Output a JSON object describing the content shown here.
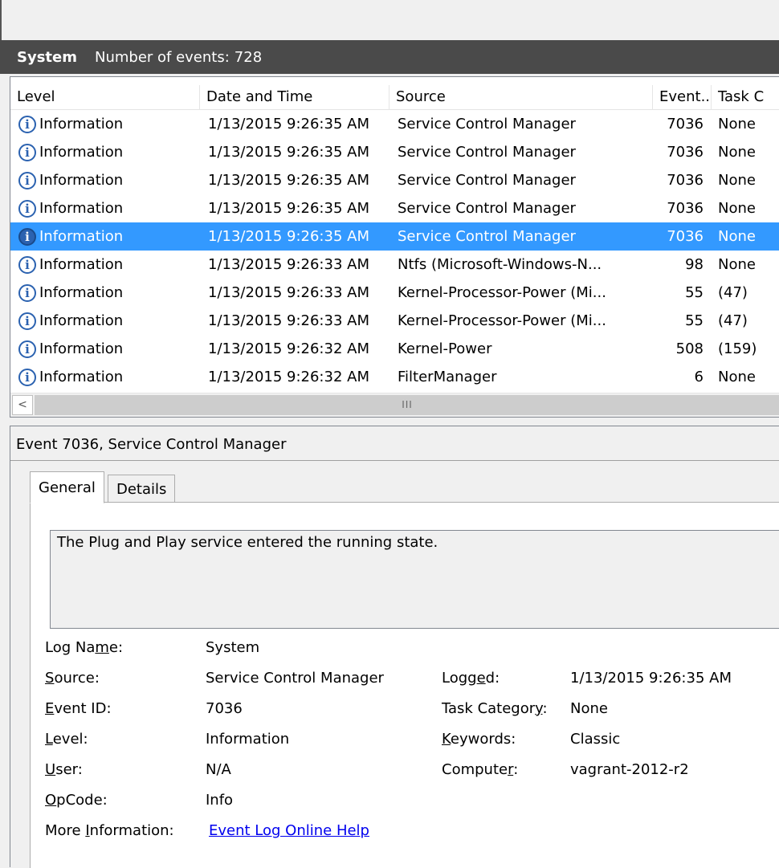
{
  "log": {
    "name": "System",
    "events_label": "Number of events:",
    "events_count": "728"
  },
  "columns": [
    "Level",
    "Date and Time",
    "Source",
    "Event...",
    "Task C"
  ],
  "events": [
    {
      "level": "Information",
      "date": "1/13/2015 9:26:35 AM",
      "source": "Service Control Manager",
      "event_id": "7036",
      "task": "None",
      "selected": false
    },
    {
      "level": "Information",
      "date": "1/13/2015 9:26:35 AM",
      "source": "Service Control Manager",
      "event_id": "7036",
      "task": "None",
      "selected": false
    },
    {
      "level": "Information",
      "date": "1/13/2015 9:26:35 AM",
      "source": "Service Control Manager",
      "event_id": "7036",
      "task": "None",
      "selected": false
    },
    {
      "level": "Information",
      "date": "1/13/2015 9:26:35 AM",
      "source": "Service Control Manager",
      "event_id": "7036",
      "task": "None",
      "selected": false
    },
    {
      "level": "Information",
      "date": "1/13/2015 9:26:35 AM",
      "source": "Service Control Manager",
      "event_id": "7036",
      "task": "None",
      "selected": true
    },
    {
      "level": "Information",
      "date": "1/13/2015 9:26:33 AM",
      "source": "Ntfs (Microsoft-Windows-N...",
      "event_id": "98",
      "task": "None",
      "selected": false
    },
    {
      "level": "Information",
      "date": "1/13/2015 9:26:33 AM",
      "source": "Kernel-Processor-Power (Mi...",
      "event_id": "55",
      "task": "(47)",
      "selected": false
    },
    {
      "level": "Information",
      "date": "1/13/2015 9:26:33 AM",
      "source": "Kernel-Processor-Power (Mi...",
      "event_id": "55",
      "task": "(47)",
      "selected": false
    },
    {
      "level": "Information",
      "date": "1/13/2015 9:26:32 AM",
      "source": "Kernel-Power",
      "event_id": "508",
      "task": "(159)",
      "selected": false
    },
    {
      "level": "Information",
      "date": "1/13/2015 9:26:32 AM",
      "source": "FilterManager",
      "event_id": "6",
      "task": "None",
      "selected": false
    }
  ],
  "scrollbar": {
    "left_arrow": "<",
    "grip": "III"
  },
  "detail": {
    "title": "Event 7036, Service Control Manager",
    "tabs": [
      "General",
      "Details"
    ],
    "message": "The Plug and Play service entered the running state.",
    "labels": {
      "log_name": "Log Name:",
      "source": "Source:",
      "event_id": "Event ID:",
      "level": "Level:",
      "user": "User:",
      "opcode": "OpCode:",
      "more_info": "More Information:",
      "logged": "Logged:",
      "task_category": "Task Category:",
      "keywords": "Keywords:",
      "computer": "Computer:"
    },
    "values": {
      "log_name": "System",
      "source": "Service Control Manager",
      "event_id": "7036",
      "level": "Information",
      "user": "N/A",
      "opcode": "Info",
      "more_info_link": "Event Log Online Help",
      "logged": "1/13/2015 9:26:35 AM",
      "task_category": "None",
      "keywords": "Classic",
      "computer": "vagrant-2012-r2"
    }
  },
  "icons": {
    "level_icon": "information-icon"
  },
  "colors": {
    "selection": "#3399ff",
    "titlebar": "#4a4a4a",
    "link": "#0000ee"
  }
}
